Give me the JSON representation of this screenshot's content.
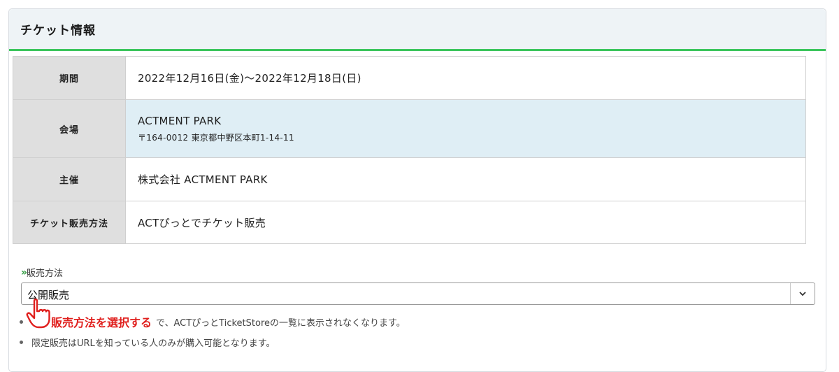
{
  "panel": {
    "title": "チケット情報"
  },
  "info_rows": [
    {
      "label": "期間",
      "value": "2022年12月16日(金)〜2022年12月18日(日)"
    },
    {
      "label": "会場",
      "value": "ACTMENT PARK",
      "sub": "〒164-0012 東京都中野区本町1-14-11"
    },
    {
      "label": "主催",
      "value": "株式会社 ACTMENT PARK"
    },
    {
      "label": "チケット販売方法",
      "value": "ACTぴっとでチケット販売"
    }
  ],
  "sale_method": {
    "label_prefix": "»",
    "label": "販売方法",
    "selected": "公開販売",
    "tooltip": "販売方法を選択する"
  },
  "notes": [
    "で、ACTぴっとTicketStoreの一覧に表示されなくなります。",
    "限定販売はURLを知っている人のみが購入可能となります。"
  ],
  "colors": {
    "accent_green": "#3cc55d",
    "tooltip_red": "#e0201e",
    "highlight_row": "#dfeef5"
  }
}
